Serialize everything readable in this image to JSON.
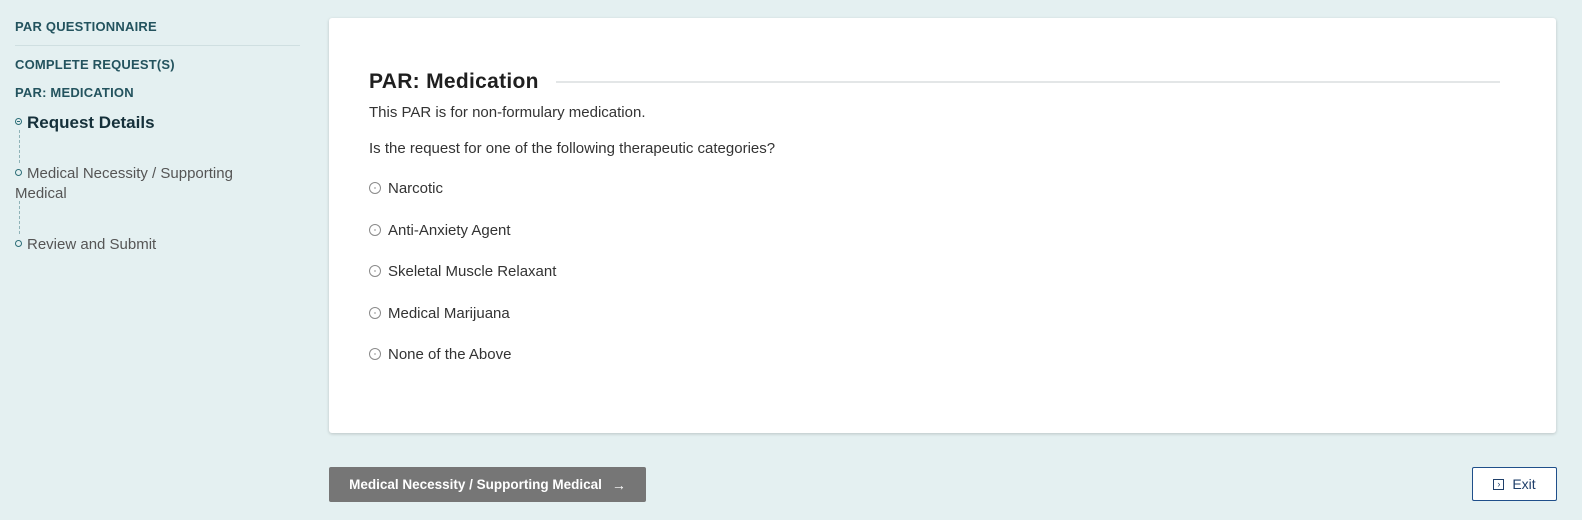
{
  "sidebar": {
    "questionnaire_heading": "PAR QUESTIONNAIRE",
    "complete_heading": "COMPLETE REQUEST(S)",
    "medication_heading": "PAR: MEDICATION",
    "steps": [
      {
        "label": "Request Details",
        "state": "active"
      },
      {
        "label": "Medical Necessity / Supporting Medical",
        "state": "pending"
      },
      {
        "label": "Review and Submit",
        "state": "pending"
      }
    ]
  },
  "main": {
    "title": "PAR: Medication",
    "description": "This PAR is for non-formulary medication.",
    "question": "Is the request for one of the following therapeutic categories?",
    "options": [
      "Narcotic",
      "Anti-Anxiety Agent",
      "Skeletal Muscle Relaxant",
      "Medical Marijuana",
      "None of the Above"
    ]
  },
  "footer": {
    "next_label": "Medical Necessity / Supporting Medical",
    "next_icon": "arrow-right-icon",
    "exit_label": "Exit",
    "exit_icon": "exit-icon"
  },
  "colors": {
    "background": "#e4f0f1",
    "heading": "#23535e",
    "next_button": "#767676",
    "exit_border": "#1f4f8a"
  }
}
